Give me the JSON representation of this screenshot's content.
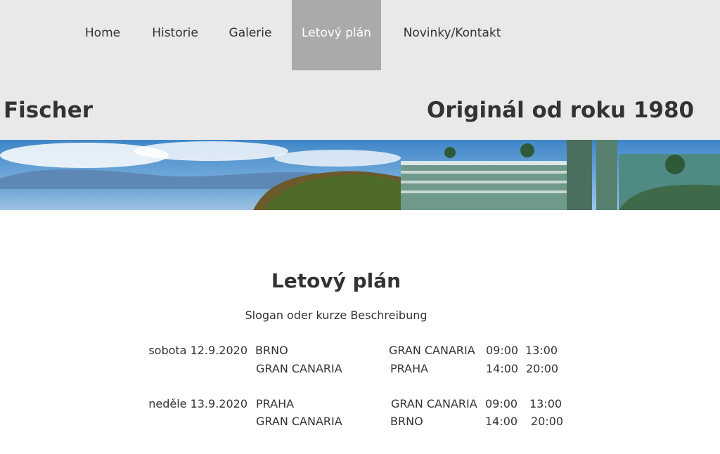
{
  "nav": {
    "items": [
      {
        "label": "Home"
      },
      {
        "label": "Historie"
      },
      {
        "label": "Galerie"
      },
      {
        "label": "Letový plán",
        "active": true
      },
      {
        "label": "Novinky/Kontakt"
      }
    ]
  },
  "brand": {
    "name": "Fischer",
    "tagline": "Originál od roku 1980"
  },
  "main": {
    "title": "Letový plán",
    "slogan": "Slogan oder kurze Beschreibung"
  },
  "schedule": [
    {
      "date": "sobota 12.9.2020",
      "flights": [
        {
          "from": "BRNO",
          "to": "GRAN CANARIA",
          "depart": "09:00",
          "arrive": "13:00"
        },
        {
          "from": "GRAN CANARIA",
          "to": "PRAHA",
          "depart": "14:00",
          "arrive": "20:00"
        }
      ]
    },
    {
      "date": "neděle 13.9.2020",
      "flights": [
        {
          "from": "PRAHA",
          "to": "GRAN CANARIA",
          "depart": "09:00",
          "arrive": "13:00"
        },
        {
          "from": "GRAN CANARIA",
          "to": "BRNO",
          "depart": "14:00",
          "arrive": "20:00"
        }
      ]
    }
  ],
  "colors": {
    "header_bg": "#e9e9e9",
    "nav_active_bg": "#aaaaaa",
    "text": "#333333"
  }
}
